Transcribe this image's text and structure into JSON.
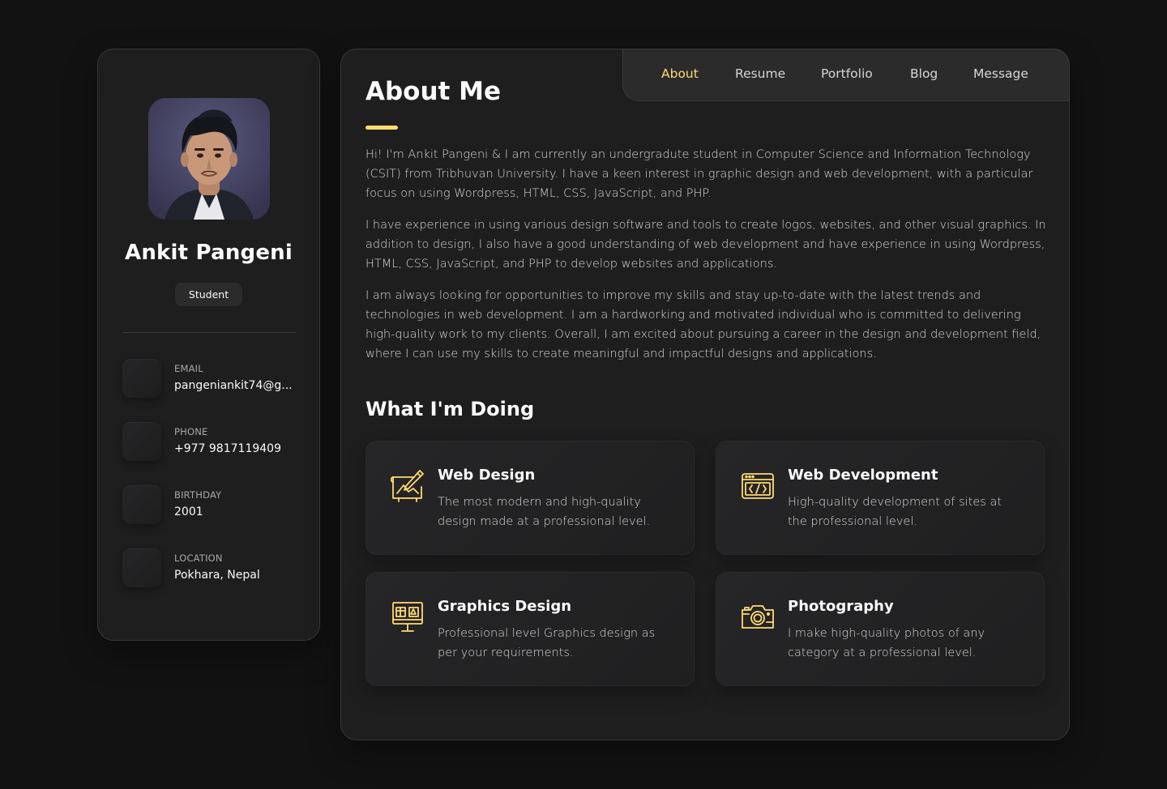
{
  "profile": {
    "name": "Ankit Pangeni",
    "title": "Student",
    "avatar_icon": "portrait-photo"
  },
  "contacts": [
    {
      "label": "Email",
      "value": "pangeniankit74@g...",
      "icon": "mail-icon"
    },
    {
      "label": "Phone",
      "value": "+977 9817119409",
      "icon": "phone-icon"
    },
    {
      "label": "Birthday",
      "value": "2001",
      "icon": "calendar-icon"
    },
    {
      "label": "Location",
      "value": "Pokhara, Nepal",
      "icon": "location-icon"
    }
  ],
  "nav": {
    "items": [
      "About",
      "Resume",
      "Portfolio",
      "Blog",
      "Message"
    ],
    "active": "About"
  },
  "about": {
    "title": "About Me",
    "paragraphs": [
      "Hi! I'm Ankit Pangeni & I am currently an undergradute student in Computer Science and Information Technology (CSIT) from Tribhuvan University. I have a keen interest in graphic design and web development, with a particular focus on using Wordpress, HTML, CSS, JavaScript, and PHP.",
      "I have experience in using various design software and tools to create logos, websites, and other visual graphics. In addition to design, I also have a good understanding of web development and have experience in using Wordpress, HTML, CSS, JavaScript, and PHP to develop websites and applications.",
      "I am always looking for opportunities to improve my skills and stay up-to-date with the latest trends and technologies in web development. I am a hardworking and motivated individual who is committed to delivering high-quality work to my clients. Overall, I am excited about pursuing a career in the design and development field, where I can use my skills to create meaningful and impactful designs and applications."
    ]
  },
  "services": {
    "title": "What I'm Doing",
    "items": [
      {
        "title": "Web Design",
        "text": "The most modern and high-quality design made at a professional level.",
        "icon": "design-icon"
      },
      {
        "title": "Web Development",
        "text": "High-quality development of sites at the professional level.",
        "icon": "code-window-icon"
      },
      {
        "title": "Graphics Design",
        "text": "Professional level Graphics design as per your requirements.",
        "icon": "monitor-design-icon"
      },
      {
        "title": "Photography",
        "text": "I make high-quality photos of any category at a professional level.",
        "icon": "camera-icon"
      }
    ]
  },
  "colors": {
    "accent": "#ffdb70",
    "background": "#121212",
    "card": "#1e1e1f",
    "text": "#d6d6d6"
  }
}
